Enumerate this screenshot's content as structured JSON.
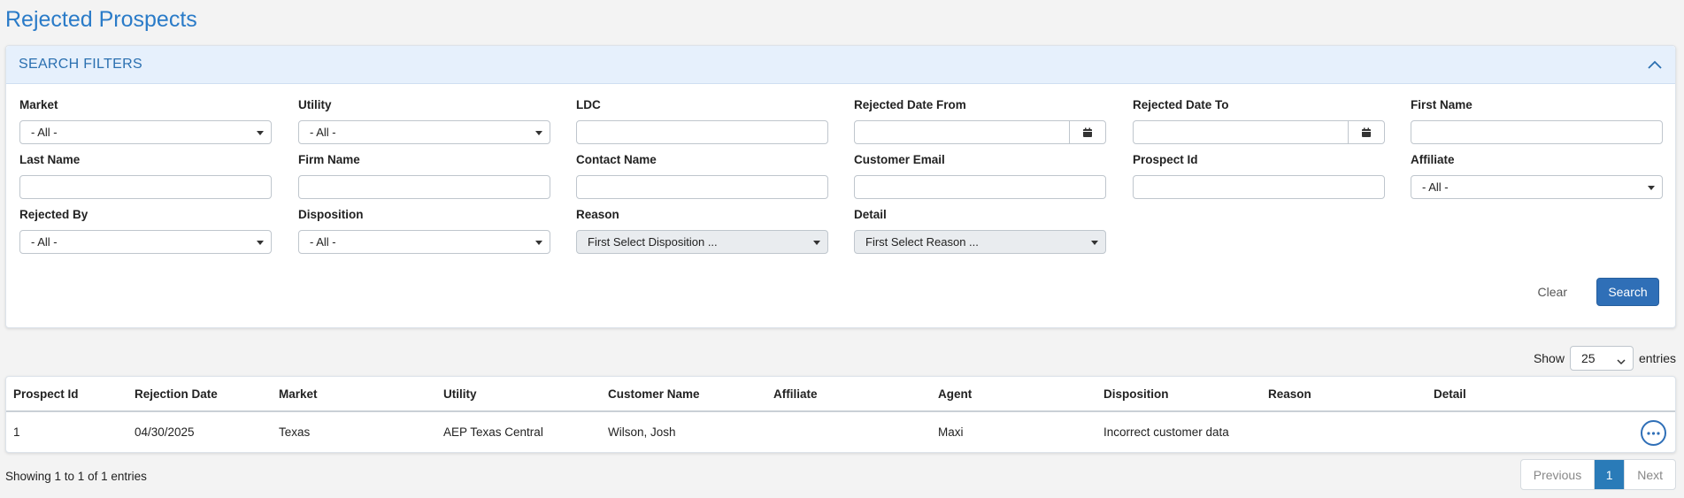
{
  "page": {
    "title": "Rejected Prospects"
  },
  "filters": {
    "header": "SEARCH FILTERS",
    "market": {
      "label": "Market",
      "value": "- All -"
    },
    "utility": {
      "label": "Utility",
      "value": "- All -"
    },
    "ldc": {
      "label": "LDC",
      "value": ""
    },
    "rejected_date_from": {
      "label": "Rejected Date From",
      "value": ""
    },
    "rejected_date_to": {
      "label": "Rejected Date To",
      "value": ""
    },
    "first_name": {
      "label": "First Name",
      "value": ""
    },
    "last_name": {
      "label": "Last Name",
      "value": ""
    },
    "firm_name": {
      "label": "Firm Name",
      "value": ""
    },
    "contact_name": {
      "label": "Contact Name",
      "value": ""
    },
    "customer_email": {
      "label": "Customer Email",
      "value": ""
    },
    "prospect_id": {
      "label": "Prospect Id",
      "value": ""
    },
    "affiliate": {
      "label": "Affiliate",
      "value": "- All -"
    },
    "rejected_by": {
      "label": "Rejected By",
      "value": "- All -"
    },
    "disposition": {
      "label": "Disposition",
      "value": "- All -"
    },
    "reason": {
      "label": "Reason",
      "value": "First Select Disposition ..."
    },
    "detail": {
      "label": "Detail",
      "value": "First Select Reason ..."
    },
    "clear_label": "Clear",
    "search_label": "Search"
  },
  "entries": {
    "show_label": "Show",
    "value": "25",
    "suffix": "entries"
  },
  "table": {
    "columns": [
      "Prospect Id",
      "Rejection Date",
      "Market",
      "Utility",
      "Customer Name",
      "Affiliate",
      "Agent",
      "Disposition",
      "Reason",
      "Detail"
    ],
    "rows": [
      [
        "1",
        "04/30/2025",
        "Texas",
        "AEP Texas Central",
        "Wilson, Josh",
        "",
        "Maxi",
        "Incorrect customer data",
        "",
        ""
      ]
    ]
  },
  "footer": {
    "showing": "Showing 1 to 1 of 1 entries",
    "previous": "Previous",
    "page": "1",
    "next": "Next"
  },
  "colors": {
    "accent": "#2a7bc8",
    "button": "#2f6fb7",
    "header_bg": "#e6f0fc"
  },
  "icons": {
    "collapse": "chevron-up-icon",
    "calendar": "calendar-icon",
    "row_action": "ellipsis-icon"
  }
}
